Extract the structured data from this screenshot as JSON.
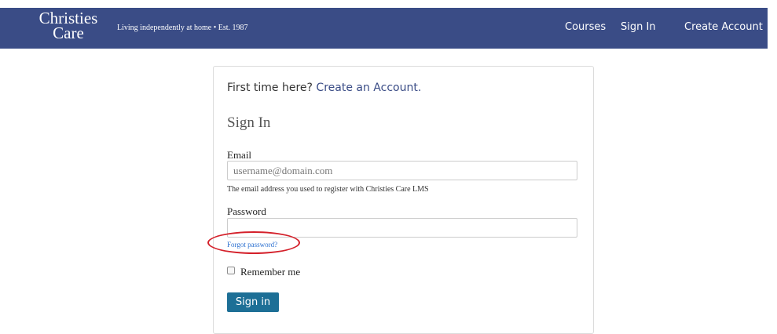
{
  "header": {
    "logo_line1": "Christies",
    "logo_line2": "Care",
    "tagline": "Living independently at home  •  Est. 1987",
    "nav": [
      "Courses",
      "Sign In",
      "Create Account"
    ],
    "bg_color": "#3a4c86"
  },
  "intro": {
    "prefix": "First time here? ",
    "link": "Create an Account."
  },
  "form": {
    "title": "Sign In",
    "email_label": "Email",
    "email_placeholder": "username@domain.com",
    "email_value": "",
    "email_help": "The email address you used to register with Christies Care LMS",
    "password_label": "Password",
    "password_value": "",
    "forgot_link": "Forgot password?",
    "remember_label": "Remember me",
    "remember_checked": false,
    "submit_label": "Sign in",
    "button_color": "#1d6f96",
    "highlight_color": "#d4202a"
  }
}
